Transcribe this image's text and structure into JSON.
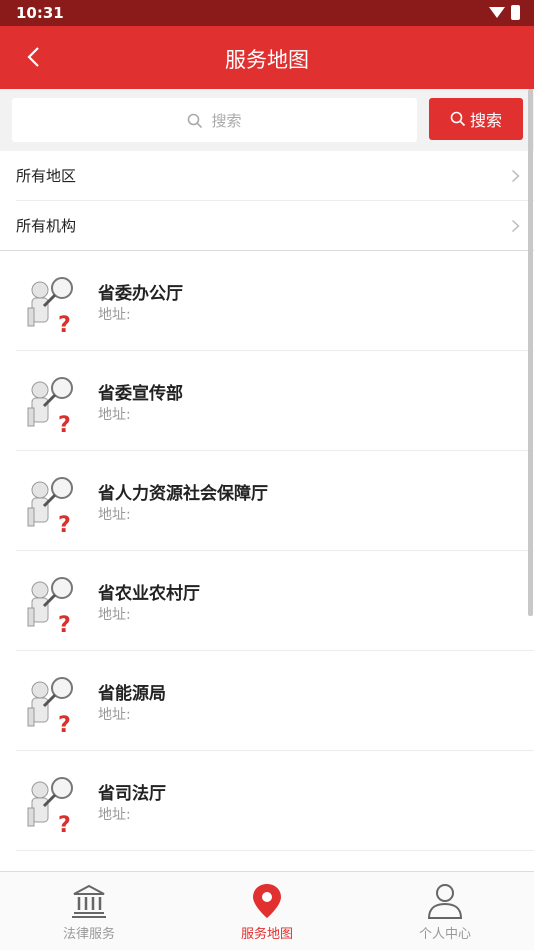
{
  "status_bar": {
    "time": "10:31",
    "icons": [
      "wifi-icon",
      "battery-icon"
    ]
  },
  "header": {
    "title": "服务地图",
    "back_icon": "chevron-left-icon"
  },
  "search": {
    "placeholder": "搜索",
    "button_label": "搜索"
  },
  "filters": [
    {
      "label": "所有地区"
    },
    {
      "label": "所有机构"
    }
  ],
  "institutions": [
    {
      "name": "省委办公厅",
      "address": "地址:"
    },
    {
      "name": "省委宣传部",
      "address": "地址:"
    },
    {
      "name": "省人力资源社会保障厅",
      "address": "地址:"
    },
    {
      "name": "省农业农村厅",
      "address": "地址:"
    },
    {
      "name": "省能源局",
      "address": "地址:"
    },
    {
      "name": "省司法厅",
      "address": "地址:"
    }
  ],
  "bottom_nav": [
    {
      "label": "法律服务",
      "icon": "bank-building-icon",
      "active": false
    },
    {
      "label": "服务地图",
      "icon": "map-pin-icon",
      "active": true
    },
    {
      "label": "个人中心",
      "icon": "person-icon",
      "active": false
    }
  ],
  "colors": {
    "accent": "#e0302f",
    "status_bar": "#8b1a1a"
  }
}
